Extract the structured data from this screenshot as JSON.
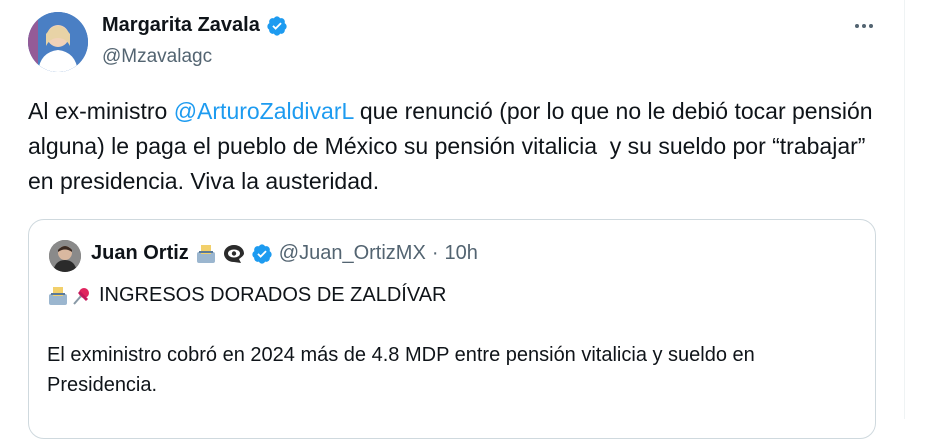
{
  "tweet": {
    "author": {
      "display_name": "Margarita Zavala",
      "handle": "@Mzavalagc"
    },
    "text_before_mention": "Al ex-ministro ",
    "mention": "@ArturoZaldivarL",
    "text_after_mention": " que renunció (por lo que no le debió tocar pensión alguna) le paga el pueblo de México su pensión vitalicia  y su sueldo por “trabajar” en presidencia. Viva la austeridad.",
    "more_icon": "more-horizontal-icon"
  },
  "quote": {
    "author": {
      "display_name": "Juan Ortiz",
      "handle": "@Juan_OrtizMX",
      "separator": "·",
      "time": "10h"
    },
    "title": "INGRESOS DORADOS DE ZALDÍVAR",
    "text": "El exministro cobró en 2024 más de 4.8 MDP entre pensión vitalicia y sueldo en Presidencia."
  },
  "colors": {
    "accent": "#1d9bf0",
    "text": "#0f1419",
    "muted": "#536471",
    "border": "#cfd9de"
  }
}
